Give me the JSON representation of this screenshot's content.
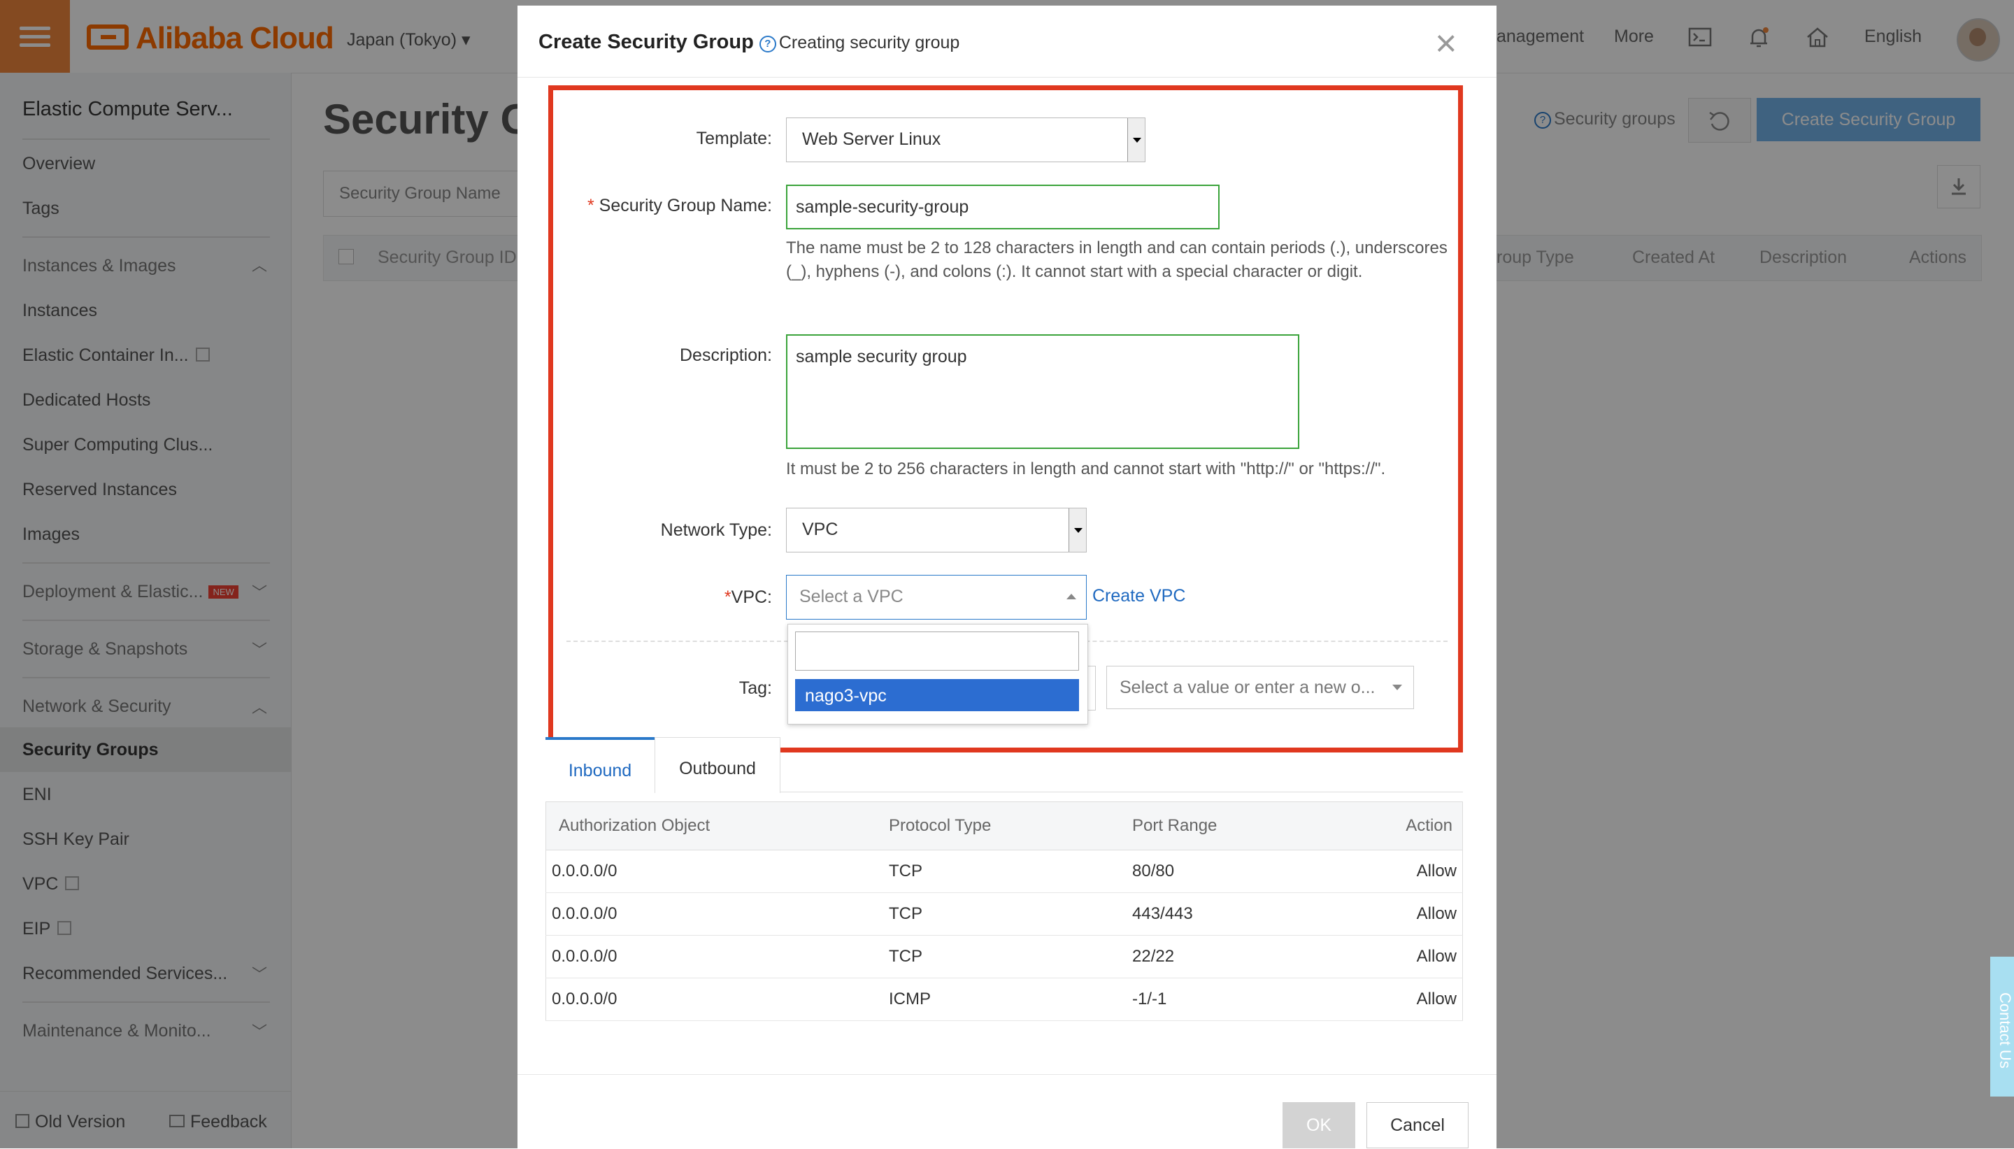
{
  "topbar": {
    "logo": "Alibaba Cloud",
    "region": "Japan (Tokyo) ▾",
    "nav_management": "anagement",
    "nav_more": "More",
    "nav_language": "English"
  },
  "sidebar": {
    "title": "Elastic Compute Serv...",
    "items": {
      "overview": "Overview",
      "tags": "Tags",
      "instances_images": "Instances & Images",
      "instances": "Instances",
      "elastic_container": "Elastic Container In...",
      "dedicated_hosts": "Dedicated Hosts",
      "super_computing": "Super Computing Clus...",
      "reserved": "Reserved Instances",
      "images": "Images",
      "deployment": "Deployment & Elastic...",
      "deployment_badge": "NEW",
      "storage": "Storage & Snapshots",
      "network_security": "Network & Security",
      "security_groups": "Security Groups",
      "eni": "ENI",
      "ssh": "SSH Key Pair",
      "vpc": "VPC",
      "eip": "EIP",
      "recommended": "Recommended Services...",
      "maintenance": "Maintenance & Monito..."
    },
    "old_version": "Old Version",
    "feedback": "Feedback"
  },
  "main": {
    "title": "Security Gr",
    "search_placeholder": "Security Group Name",
    "help_link": "Security groups",
    "create_button": "Create Security Group",
    "columns": {
      "id": "Security Group ID",
      "group_type": "roup Type",
      "created_at": "Created At",
      "description": "Description",
      "actions": "Actions"
    }
  },
  "modal": {
    "title": "Create Security Group",
    "subtitle": "Creating security group",
    "close": "×",
    "template_label": "Template:",
    "template_value": "Web Server Linux",
    "name_label": "Security Group Name:",
    "name_value": "sample-security-group",
    "name_hint": "The name must be 2 to 128 characters in length and can contain periods (.), underscores (_), hyphens (-), and colons (:). It cannot start with a special character or digit.",
    "description_label": "Description:",
    "description_value": "sample security group",
    "description_hint": "It must be 2 to 256 characters in length and cannot start with \"http://\" or \"https://\".",
    "network_type_label": "Network Type:",
    "network_type_value": "VPC",
    "vpc_label": "VPC:",
    "vpc_placeholder": "Select a VPC",
    "create_vpc_link": "Create VPC",
    "vpc_options": [
      "nago3-vpc"
    ],
    "tag_label": "Tag:",
    "tag_value_placeholder": "Select a value or enter a new o...",
    "tabs": [
      "Inbound",
      "Outbound"
    ],
    "rules_columns": [
      "Authorization Object",
      "Protocol Type",
      "Port Range",
      "Action"
    ],
    "rules": [
      [
        "0.0.0.0/0",
        "TCP",
        "80/80",
        "Allow"
      ],
      [
        "0.0.0.0/0",
        "TCP",
        "443/443",
        "Allow"
      ],
      [
        "0.0.0.0/0",
        "TCP",
        "22/22",
        "Allow"
      ],
      [
        "0.0.0.0/0",
        "ICMP",
        "-1/-1",
        "Allow"
      ]
    ],
    "ok": "OK",
    "cancel": "Cancel"
  },
  "contact": "Contact Us",
  "colors": {
    "accent_orange": "#ff6a00",
    "highlight_red": "#e0381f",
    "primary_blue": "#2c6dd1",
    "valid_green": "#3aa33a"
  }
}
